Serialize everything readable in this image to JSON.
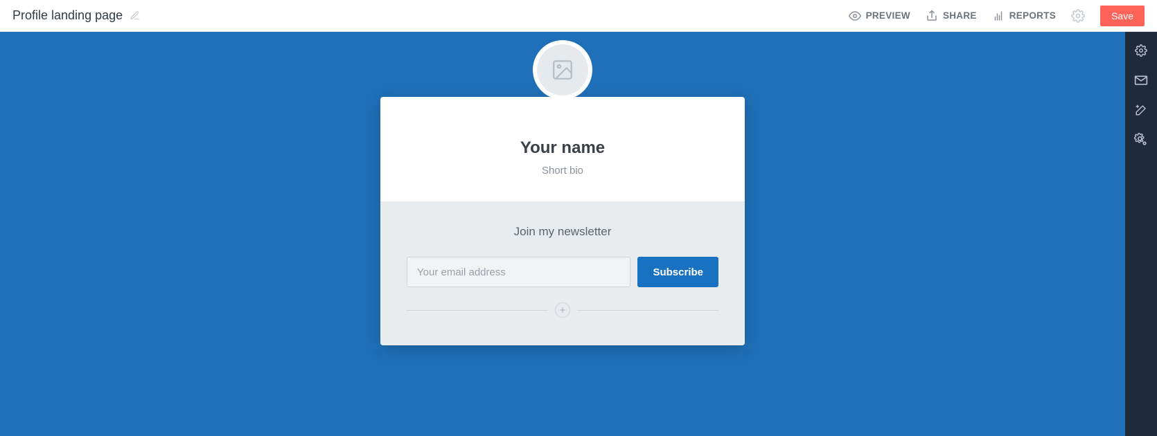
{
  "header": {
    "title": "Profile landing page",
    "preview_label": "PREVIEW",
    "share_label": "SHARE",
    "reports_label": "REPORTS",
    "save_label": "Save"
  },
  "card": {
    "name": "Your name",
    "bio": "Short bio",
    "newsletter_title": "Join my newsletter",
    "email_placeholder": "Your email address",
    "subscribe_label": "Subscribe"
  },
  "icons": {
    "edit": "pencil-icon",
    "preview": "eye-icon",
    "share": "share-icon",
    "reports": "bar-chart-icon",
    "settings": "gear-icon",
    "rail_settings": "gear-icon",
    "rail_mail": "envelope-icon",
    "rail_magic": "wand-icon",
    "rail_advanced": "gear-plus-icon",
    "avatar_placeholder": "image-placeholder-icon",
    "add": "plus-icon"
  },
  "colors": {
    "accent": "#fd6359",
    "canvas": "#1f70b8",
    "rail": "#1f2a3c",
    "primary_button": "#1971c2"
  }
}
